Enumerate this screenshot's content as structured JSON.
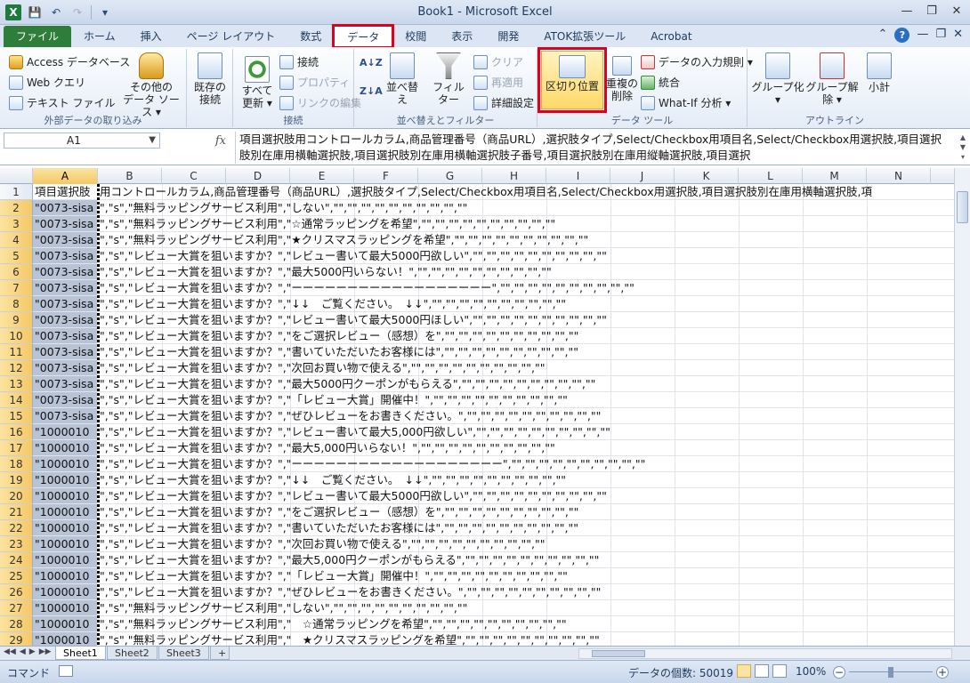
{
  "window": {
    "title": "Book1 - Microsoft Excel",
    "app_logo": "X"
  },
  "tabs": [
    {
      "label": "ファイル"
    },
    {
      "label": "ホーム"
    },
    {
      "label": "挿入"
    },
    {
      "label": "ページ レイアウト"
    },
    {
      "label": "数式"
    },
    {
      "label": "データ"
    },
    {
      "label": "校閲"
    },
    {
      "label": "表示"
    },
    {
      "label": "開発"
    },
    {
      "label": "ATOK拡張ツール"
    },
    {
      "label": "Acrobat"
    }
  ],
  "ribbon": {
    "external": {
      "label": "外部データの取り込み",
      "access": "Access データベース",
      "web": "Web クエリ",
      "text": "テキスト ファイル",
      "other1": "その他の",
      "other2": "データ ソース ▾",
      "existing1": "既存の",
      "existing2": "接続"
    },
    "connections": {
      "label": "接続",
      "refresh1": "すべて",
      "refresh2": "更新 ▾",
      "connect": "接続",
      "properties": "プロパティ",
      "editlinks": "リンクの編集"
    },
    "sortfilter": {
      "label": "並べ替えとフィルター",
      "sort": "並べ替え",
      "filter": "フィルター",
      "clear": "クリア",
      "reapply": "再適用",
      "advanced": "詳細設定"
    },
    "datatools": {
      "label": "データ ツール",
      "split": "区切り位置",
      "dup1": "重複の",
      "dup2": "削除",
      "validation": "データの入力規則 ▾",
      "consolidate": "統合",
      "whatif": "What-If 分析 ▾"
    },
    "outline": {
      "label": "アウトライン",
      "group": "グループ化 ▾",
      "ungroup": "グループ解除 ▾",
      "subtotal": "小計"
    }
  },
  "formula_bar": {
    "namebox": "A1",
    "fx": "fx",
    "content": "項目選択肢用コントロールカラム,商品管理番号（商品URL）,選択肢タイプ,Select/Checkbox用項目名,Select/Checkbox用選択肢,項目選択肢別在庫用横軸選択肢,項目選択肢別在庫用横軸選択肢子番号,項目選択肢別在庫用縦軸選択肢,項目選択"
  },
  "columns": [
    "A",
    "B",
    "C",
    "D",
    "E",
    "F",
    "G",
    "H",
    "I",
    "J",
    "K",
    "L",
    "M",
    "N"
  ],
  "rows": [
    {
      "n": "1",
      "a": "項目選択肢",
      "t": "用コントロールカラム,商品管理番号（商品URL）,選択肢タイプ,Select/Checkbox用項目名,Select/Checkbox用選択肢,項目選択肢別在庫用横軸選択肢,項"
    },
    {
      "n": "2",
      "a": "\"0073-sisa",
      "t": "\",\"s\",\"無料ラッピングサービス利用\",\"しない\",\"\",\"\",\"\",\"\",\"\",\"\",\"\",\"\",\"\",\"\""
    },
    {
      "n": "3",
      "a": "\"0073-sisa",
      "t": "\",\"s\",\"無料ラッピングサービス利用\",\"☆通常ラッピングを希望\",\"\",\"\",\"\",\"\",\"\",\"\",\"\",\"\",\"\",\"\""
    },
    {
      "n": "4",
      "a": "\"0073-sisa",
      "t": "\",\"s\",\"無料ラッピングサービス利用\",\"★クリスマスラッピングを希望\",\"\",\"\",\"\",\"\",\"\",\"\",\"\",\"\",\"\",\"\""
    },
    {
      "n": "5",
      "a": "\"0073-sisa",
      "t": "\",\"s\",\"レビュー大賞を狙いますか？\",\"レビュー書いて最大5000円欲しい\",\"\",\"\",\"\",\"\",\"\",\"\",\"\",\"\",\"\",\"\""
    },
    {
      "n": "6",
      "a": "\"0073-sisa",
      "t": "\",\"s\",\"レビュー大賞を狙いますか？\",\"最大5000円いらない！\",\"\",\"\",\"\",\"\",\"\",\"\",\"\",\"\",\"\",\"\""
    },
    {
      "n": "7",
      "a": "\"0073-sisa",
      "t": "\",\"s\",\"レビュー大賞を狙いますか？\",\"ーーーーーーーーーーーーーーーーーー\",\"\",\"\",\"\",\"\",\"\",\"\",\"\",\"\",\"\",\"\""
    },
    {
      "n": "8",
      "a": "\"0073-sisa",
      "t": "\",\"s\",\"レビュー大賞を狙いますか？\",\"↓↓　ご覧ください。　↓↓\",\"\",\"\",\"\",\"\",\"\",\"\",\"\",\"\",\"\",\"\""
    },
    {
      "n": "9",
      "a": "\"0073-sisa",
      "t": "\",\"s\",\"レビュー大賞を狙いますか？\",\"レビュー書いて最大5000円ほしい\",\"\",\"\",\"\",\"\",\"\",\"\",\"\",\"\",\"\",\"\""
    },
    {
      "n": "10",
      "a": "\"0073-sisa",
      "t": "\",\"s\",\"レビュー大賞を狙いますか？\",\"をご選択レビュー（感想）を\",\"\",\"\",\"\",\"\",\"\",\"\",\"\",\"\",\"\",\"\""
    },
    {
      "n": "11",
      "a": "\"0073-sisa",
      "t": "\",\"s\",\"レビュー大賞を狙いますか？\",\"書いていただいたお客様には\",\"\",\"\",\"\",\"\",\"\",\"\",\"\",\"\",\"\",\"\""
    },
    {
      "n": "12",
      "a": "\"0073-sisa",
      "t": "\",\"s\",\"レビュー大賞を狙いますか？\",\"次回お買い物で使える\",\"\",\"\",\"\",\"\",\"\",\"\",\"\",\"\",\"\",\"\""
    },
    {
      "n": "13",
      "a": "\"0073-sisa",
      "t": "\",\"s\",\"レビュー大賞を狙いますか？\",\"最大5000円クーポンがもらえる\",\"\",\"\",\"\",\"\",\"\",\"\",\"\",\"\",\"\",\"\""
    },
    {
      "n": "14",
      "a": "\"0073-sisa",
      "t": "\",\"s\",\"レビュー大賞を狙いますか？\",\"「レビュー大賞」開催中！\",\"\",\"\",\"\",\"\",\"\",\"\",\"\",\"\",\"\",\"\""
    },
    {
      "n": "15",
      "a": "\"0073-sisa",
      "t": "\",\"s\",\"レビュー大賞を狙いますか？\",\"ぜひレビューをお書きください。\",\"\",\"\",\"\",\"\",\"\",\"\",\"\",\"\",\"\",\"\""
    },
    {
      "n": "16",
      "a": "\"1000010",
      "t": "\",\"s\",\"レビュー大賞を狙いますか？\",\"レビュー書いて最大5,000円欲しい\",\"\",\"\",\"\",\"\",\"\",\"\",\"\",\"\",\"\",\"\""
    },
    {
      "n": "17",
      "a": "\"1000010",
      "t": "\",\"s\",\"レビュー大賞を狙いますか？\",\"最大5,000円いらない！\",\"\",\"\",\"\",\"\",\"\",\"\",\"\",\"\",\"\",\"\""
    },
    {
      "n": "18",
      "a": "\"1000010",
      "t": "\",\"s\",\"レビュー大賞を狙いますか？\",\"ーーーーーーーーーーーーーーーーーーー\",\"\",\"\",\"\",\"\",\"\",\"\",\"\",\"\",\"\",\"\""
    },
    {
      "n": "19",
      "a": "\"1000010",
      "t": "\",\"s\",\"レビュー大賞を狙いますか？\",\"↓↓　ご覧ください。　↓↓\",\"\",\"\",\"\",\"\",\"\",\"\",\"\",\"\",\"\",\"\""
    },
    {
      "n": "20",
      "a": "\"1000010",
      "t": "\",\"s\",\"レビュー大賞を狙いますか？\",\"レビュー書いて最大5000円欲しい\",\"\",\"\",\"\",\"\",\"\",\"\",\"\",\"\",\"\",\"\""
    },
    {
      "n": "21",
      "a": "\"1000010",
      "t": "\",\"s\",\"レビュー大賞を狙いますか？\",\"をご選択レビュー（感想）を\",\"\",\"\",\"\",\"\",\"\",\"\",\"\",\"\",\"\",\"\""
    },
    {
      "n": "22",
      "a": "\"1000010",
      "t": "\",\"s\",\"レビュー大賞を狙いますか？\",\"書いていただいたお客様には\",\"\",\"\",\"\",\"\",\"\",\"\",\"\",\"\",\"\",\"\""
    },
    {
      "n": "23",
      "a": "\"1000010",
      "t": "\",\"s\",\"レビュー大賞を狙いますか？\",\"次回お買い物で使える\",\"\",\"\",\"\",\"\",\"\",\"\",\"\",\"\",\"\",\"\""
    },
    {
      "n": "24",
      "a": "\"1000010",
      "t": "\",\"s\",\"レビュー大賞を狙いますか？\",\"最大5,000円クーポンがもらえる\",\"\",\"\",\"\",\"\",\"\",\"\",\"\",\"\",\"\",\"\""
    },
    {
      "n": "25",
      "a": "\"1000010",
      "t": "\",\"s\",\"レビュー大賞を狙いますか？\",\"「レビュー大賞」開催中！\",\"\",\"\",\"\",\"\",\"\",\"\",\"\",\"\",\"\",\"\""
    },
    {
      "n": "26",
      "a": "\"1000010",
      "t": "\",\"s\",\"レビュー大賞を狙いますか？\",\"ぜひレビューをお書きください。\",\"\",\"\",\"\",\"\",\"\",\"\",\"\",\"\",\"\",\"\""
    },
    {
      "n": "27",
      "a": "\"1000010",
      "t": "\",\"s\",\"無料ラッピングサービス利用\",\"しない\",\"\",\"\",\"\",\"\",\"\",\"\",\"\",\"\",\"\",\"\""
    },
    {
      "n": "28",
      "a": "\"1000010",
      "t": "\",\"s\",\"無料ラッピングサービス利用\",\"　☆通常ラッピングを希望\",\"\",\"\",\"\",\"\",\"\",\"\",\"\",\"\",\"\",\"\""
    },
    {
      "n": "29",
      "a": "\"1000010",
      "t": "\",\"s\",\"無料ラッピングサービス利用\",\"　★クリスマスラッピングを希望\",\"\",\"\",\"\",\"\",\"\",\"\",\"\",\"\",\"\",\"\""
    }
  ],
  "sheets": [
    {
      "name": "Sheet1"
    },
    {
      "name": "Sheet2"
    },
    {
      "name": "Sheet3"
    }
  ],
  "status": {
    "mode": "コマンド",
    "count": "データの個数: 50019",
    "zoom": "100%"
  }
}
